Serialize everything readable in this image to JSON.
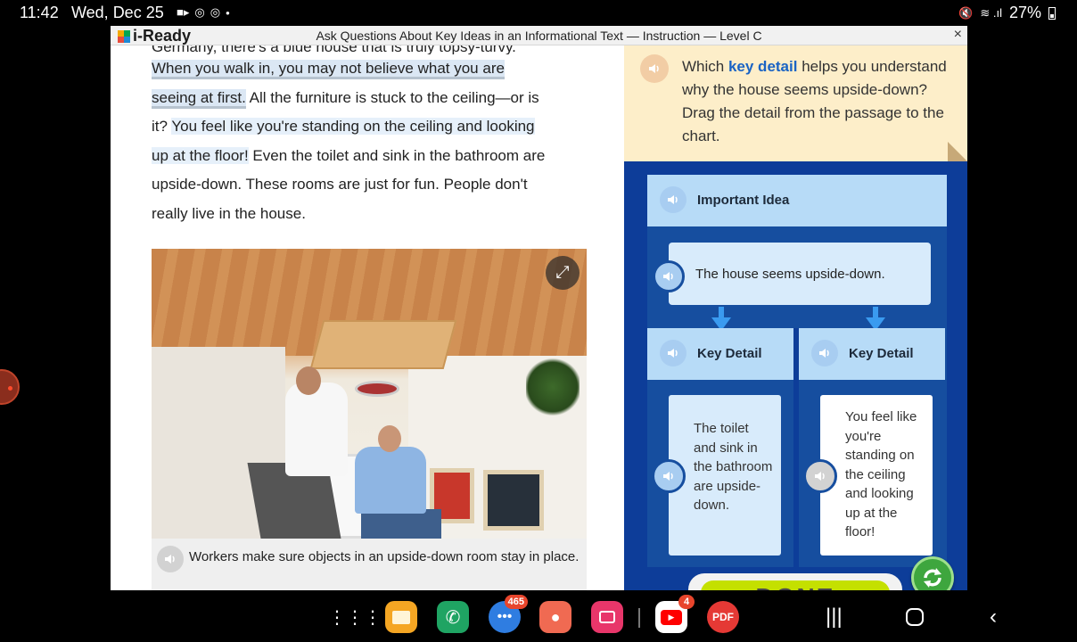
{
  "status_bar": {
    "time": "11:42",
    "date": "Wed, Dec 25",
    "battery": "27%"
  },
  "window": {
    "app_name": "i-Ready",
    "title": "Ask Questions About Key Ideas in an Informational Text — Instruction — Level C",
    "close_label": "×"
  },
  "passage": {
    "cut_line": "Germany, there's a blue house that is truly topsy-turvy.",
    "seg1": "When you walk in, you may not believe what you are",
    "seg2": "seeing at first.",
    "seg3": " All the furniture is stuck to the ceiling—or is",
    "seg4": "it? ",
    "seg5": "You feel like you're standing on the ceiling and looking",
    "seg6": "up at the floor!",
    "seg7": " Even the toilet and sink in the bathroom are",
    "seg8": "upside-down. These rooms are just for fun. People don't",
    "seg9": "really live in the house."
  },
  "photo": {
    "expand_icon": "expand-arrows-icon",
    "caption": "Workers make sure objects in an upside-down room stay in place."
  },
  "question": {
    "before": "Which ",
    "keyword": "key detail",
    "after": " helps you understand why the house seems upside-down? Drag the detail from the passage to the chart."
  },
  "chart": {
    "idea_header": "Important Idea",
    "idea_text": "The house seems upside-down.",
    "detail_header_1": "Key Detail",
    "detail_header_2": "Key Detail",
    "detail_text_1": "The toilet and sink in the bathroom are upside-down.",
    "detail_text_2": "You feel like you're standing on the ceiling and looking up at the floor!",
    "done_label": "DONE"
  },
  "colors": {
    "panel_blue": "#0d3d99",
    "chart_blue": "#164e9f",
    "header_light_blue": "#b7dbf7",
    "card_blue": "#d8ebfb",
    "prompt_yellow": "#fdeec9",
    "keyword_blue": "#1a63c4",
    "done_green": "#c4e000",
    "refresh_green": "#3ea63e"
  },
  "taskbar": {
    "messages_badge": "465",
    "youtube_badge": "4",
    "pdf_label": "PDF"
  }
}
